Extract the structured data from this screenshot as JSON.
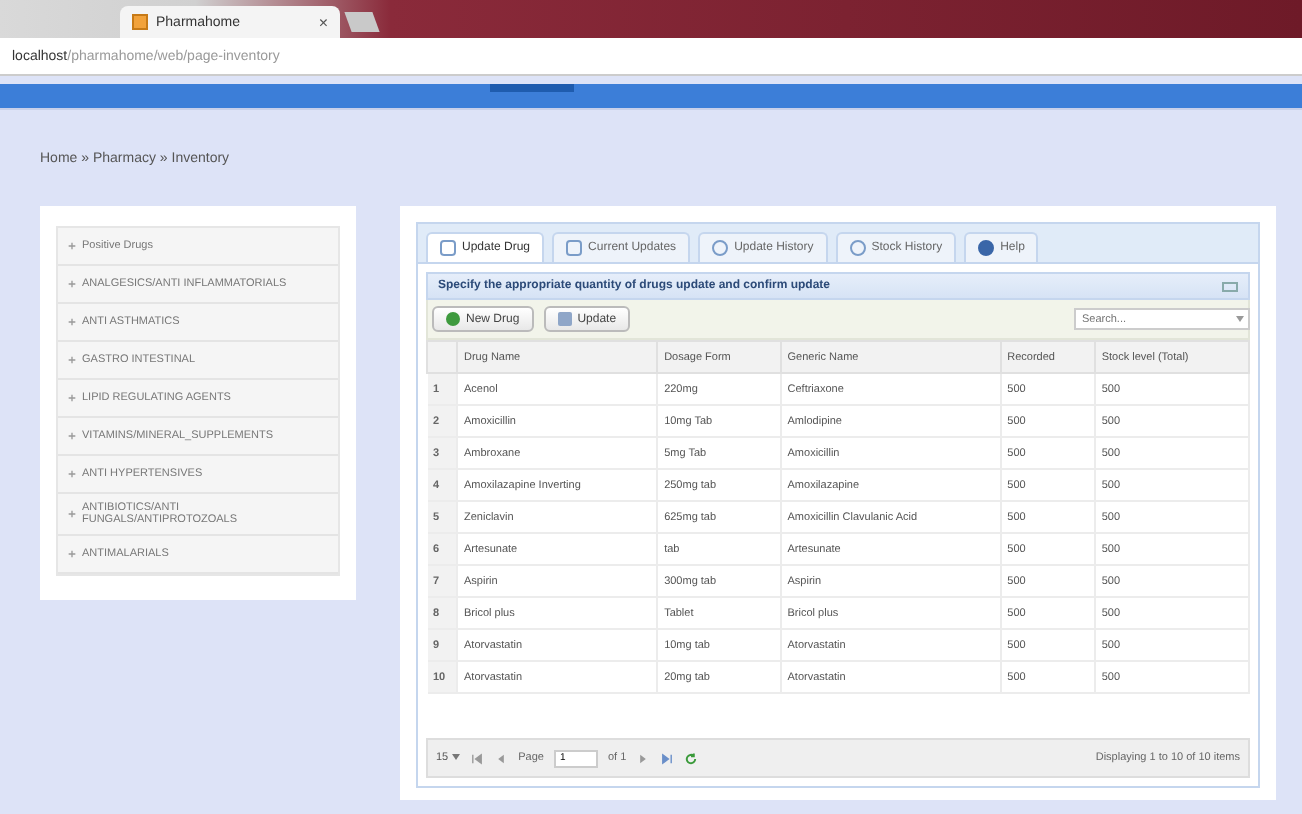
{
  "browser": {
    "tab_title": "Pharmahome",
    "tab_close": "×",
    "url_host": "localhost",
    "url_path": "/pharmahome/web/page-inventory"
  },
  "breadcrumb": "Home » Pharmacy » Inventory",
  "sidebar": {
    "items": [
      {
        "label": "Positive Drugs"
      },
      {
        "label": "ANALGESICS/ANTI INFLAMMATORIALS"
      },
      {
        "label": "ANTI ASTHMATICS"
      },
      {
        "label": "GASTRO INTESTINAL"
      },
      {
        "label": "LIPID REGULATING AGENTS"
      },
      {
        "label": "VITAMINS/MINERAL_SUPPLEMENTS"
      },
      {
        "label": "ANTI HYPERTENSIVES"
      },
      {
        "label": "ANTIBIOTICS/ANTI FUNGALS/ANTIPROTOZOALS"
      },
      {
        "label": "ANTIMALARIALS"
      }
    ]
  },
  "tabs": [
    {
      "label": "Update Drug",
      "selected": true
    },
    {
      "label": "Current Updates",
      "selected": false
    },
    {
      "label": "Update History",
      "selected": false
    },
    {
      "label": "Stock History",
      "selected": false
    },
    {
      "label": "Help",
      "selected": false
    }
  ],
  "grid": {
    "caption": "Specify the appropriate quantity of drugs update and confirm update",
    "buttons": [
      "New Drug",
      "Update"
    ],
    "search": {
      "placeholder": "Search..."
    },
    "columns": [
      "",
      "Drug Name",
      "Dosage Form",
      "Generic Name",
      "Recorded",
      "Stock level (Total)"
    ],
    "rows": [
      [
        "1",
        "Acenol",
        "220mg",
        "Ceftriaxone",
        "500",
        "500"
      ],
      [
        "2",
        "Amoxicillin",
        "10mg Tab",
        "Amlodipine",
        "500",
        "500"
      ],
      [
        "3",
        "Ambroxane",
        "5mg Tab",
        "Amoxicillin",
        "500",
        "500"
      ],
      [
        "4",
        "Amoxilazapine Inverting",
        "250mg tab",
        "Amoxilazapine",
        "500",
        "500"
      ],
      [
        "5",
        "Zeniclavin",
        "625mg tab",
        "Amoxicillin Clavulanic Acid",
        "500",
        "500"
      ],
      [
        "6",
        "Artesunate",
        "tab",
        "Artesunate",
        "500",
        "500"
      ],
      [
        "7",
        "Aspirin",
        "300mg tab",
        "Aspirin",
        "500",
        "500"
      ],
      [
        "8",
        "Bricol plus",
        "Tablet",
        "Bricol plus",
        "500",
        "500"
      ],
      [
        "9",
        "Atorvastatin",
        "10mg tab",
        "Atorvastatin",
        "500",
        "500"
      ],
      [
        "10",
        "Atorvastatin",
        "20mg tab",
        "Atorvastatin",
        "500",
        "500"
      ]
    ],
    "pager": {
      "page_size": "15",
      "page_label": "Page",
      "page": "1",
      "of": "of 1",
      "summary": "Displaying 1 to 10 of 10 items"
    }
  }
}
